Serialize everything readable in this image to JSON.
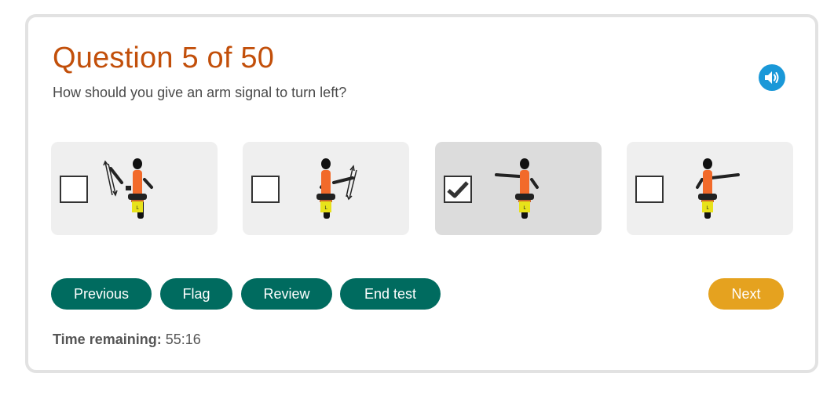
{
  "header": {
    "title": "Question 5 of 50",
    "question": "How should you give an arm signal to turn left?"
  },
  "audio": {
    "icon": "speaker-icon",
    "color": "#1a98d8"
  },
  "options": [
    {
      "checked": false,
      "arm": "left-arm-waving"
    },
    {
      "checked": false,
      "arm": "right-arm-waving"
    },
    {
      "checked": true,
      "arm": "left-arm-extended"
    },
    {
      "checked": false,
      "arm": "right-arm-extended"
    }
  ],
  "buttons": {
    "previous": "Previous",
    "flag": "Flag",
    "review": "Review",
    "end_test": "End test",
    "next": "Next"
  },
  "timer": {
    "label": "Time remaining:",
    "value": "55:16"
  },
  "colors": {
    "title": "#c24f0a",
    "primary_button": "#006b5f",
    "next_button": "#e5a21f",
    "option_bg": "#efefef",
    "option_selected_bg": "#dcdcdc"
  }
}
